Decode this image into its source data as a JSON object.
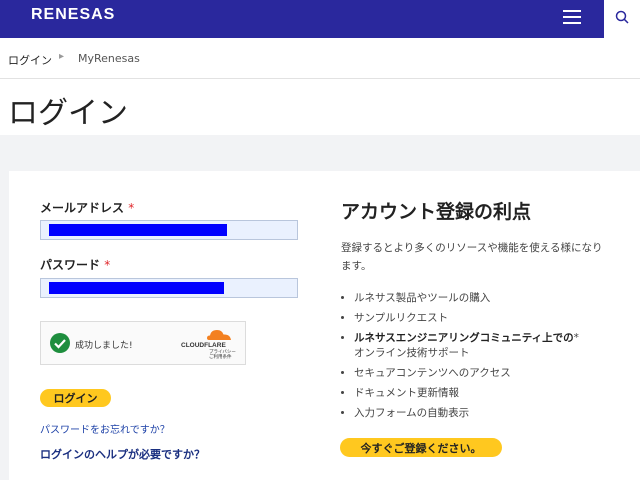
{
  "header": {
    "logo": "RENESAS"
  },
  "breadcrumb": {
    "login": "ログイン",
    "my_renesas": "MyRenesas"
  },
  "page_title": "ログイン",
  "form": {
    "email_label": "メールアドレス",
    "password_label": "パスワード",
    "required_mark": "*",
    "captcha": {
      "status": "成功しました!",
      "brand": "CLOUDFLARE",
      "privacy": "プライバシー",
      "terms": "ご利用条件"
    },
    "login_button": "ログイン",
    "forgot_password": "パスワードをお忘れですか？",
    "help_link": "ログインのヘルプが必要ですか？"
  },
  "benefits": {
    "title": "アカウント登録の利点",
    "description": "登録するとより多くのリソースや機能を使える様になります。",
    "items": [
      "ルネサス製品やツールの購入",
      "サンプルリクエスト",
      "ルネサスエンジニアリングコミュニティ上での",
      "オンライン技術サポート",
      "セキュアコンテンツへのアクセス",
      "ドキュメント更新情報",
      "入力フォームの自動表示"
    ],
    "signup_button": "今すぐご登録ください。"
  },
  "colors": {
    "header": "#2a289d",
    "accent": "#ffc81f",
    "link": "#1f43a8",
    "required": "#e0262a",
    "success": "#1e8e3e"
  }
}
